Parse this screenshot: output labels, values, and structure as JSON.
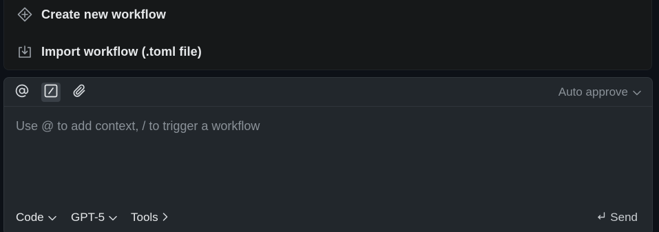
{
  "workflow_menu": {
    "items": [
      {
        "label": "Create new workflow",
        "icon": "plus-diamond-icon"
      },
      {
        "label": "Import workflow (.toml file)",
        "icon": "import-icon"
      }
    ]
  },
  "composer": {
    "toolbar": {
      "mention_icon": "at-icon",
      "workflow_icon": "slash-command-icon",
      "attach_icon": "paperclip-icon",
      "auto_approve_label": "Auto approve"
    },
    "input": {
      "placeholder": "Use @ to add context, / to trigger a workflow",
      "value": ""
    },
    "bottom": {
      "mode_label": "Code",
      "model_label": "GPT-5",
      "tools_label": "Tools",
      "send_label": "Send"
    }
  },
  "colors": {
    "panel_bg": "#161819",
    "composer_bg": "#22272c",
    "text_primary": "#e6e8ea",
    "text_muted": "#8a9198"
  }
}
